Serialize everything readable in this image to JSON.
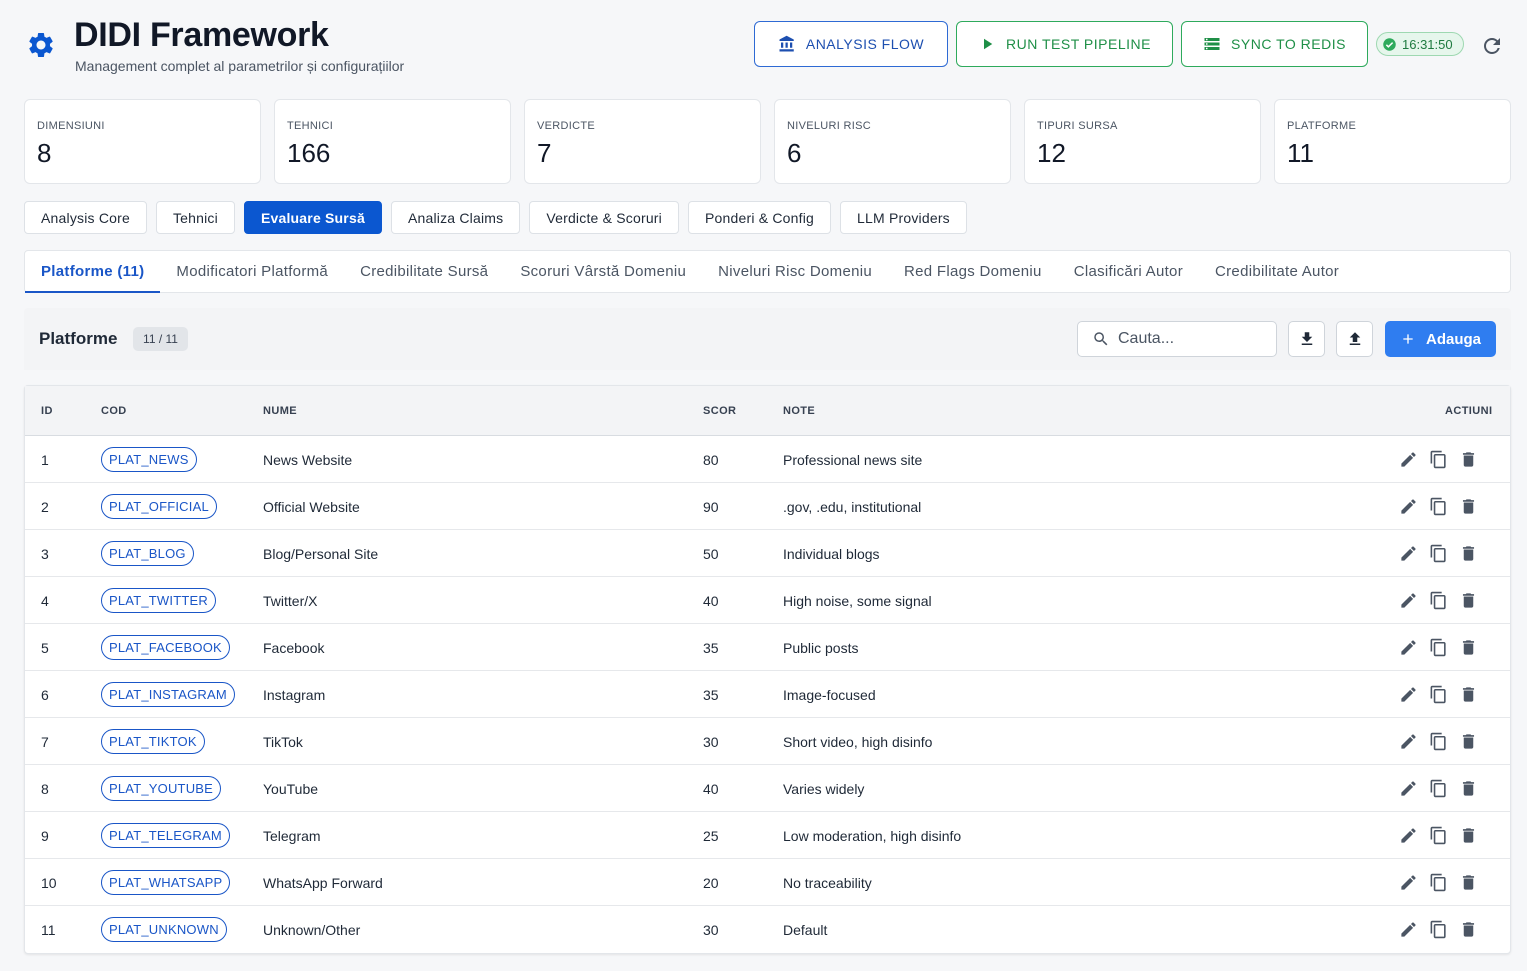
{
  "header": {
    "title": "DIDI Framework",
    "subtitle": "Management complet al parametrilor și configurațiilor",
    "buttons": {
      "analysis_flow": "ANALYSIS FLOW",
      "run_test": "RUN TEST PIPELINE",
      "sync_redis": "SYNC TO REDIS"
    },
    "time": "16:31:50"
  },
  "stats": [
    {
      "label": "DIMENSIUNI",
      "value": "8"
    },
    {
      "label": "TEHNICI",
      "value": "166"
    },
    {
      "label": "VERDICTE",
      "value": "7"
    },
    {
      "label": "NIVELURI RISC",
      "value": "6"
    },
    {
      "label": "TIPURI SURSA",
      "value": "12"
    },
    {
      "label": "PLATFORME",
      "value": "11"
    }
  ],
  "main_tabs": [
    "Analysis Core",
    "Tehnici",
    "Evaluare Sursă",
    "Analiza Claims",
    "Verdicte & Scoruri",
    "Ponderi & Config",
    "LLM Providers"
  ],
  "main_tab_active": "Evaluare Sursă",
  "sub_tabs": [
    "Platforme (11)",
    "Modificatori Platformă",
    "Credibilitate Sursă",
    "Scoruri Vârstă Domeniu",
    "Niveluri Risc Domeniu",
    "Red Flags Domeniu",
    "Clasificări Autor",
    "Credibilitate Autor"
  ],
  "sub_tab_active": "Platforme (11)",
  "toolbar": {
    "title": "Platforme",
    "count": "11 / 11",
    "search_placeholder": "Cauta...",
    "add_label": "Adauga"
  },
  "table": {
    "columns": {
      "id": "ID",
      "cod": "COD",
      "nume": "NUME",
      "scor": "SCOR",
      "note": "NOTE",
      "actiuni": "ACTIUNI"
    },
    "rows": [
      {
        "id": "1",
        "cod": "PLAT_NEWS",
        "nume": "News Website",
        "scor": "80",
        "note": "Professional news site"
      },
      {
        "id": "2",
        "cod": "PLAT_OFFICIAL",
        "nume": "Official Website",
        "scor": "90",
        "note": ".gov, .edu, institutional"
      },
      {
        "id": "3",
        "cod": "PLAT_BLOG",
        "nume": "Blog/Personal Site",
        "scor": "50",
        "note": "Individual blogs"
      },
      {
        "id": "4",
        "cod": "PLAT_TWITTER",
        "nume": "Twitter/X",
        "scor": "40",
        "note": "High noise, some signal"
      },
      {
        "id": "5",
        "cod": "PLAT_FACEBOOK",
        "nume": "Facebook",
        "scor": "35",
        "note": "Public posts"
      },
      {
        "id": "6",
        "cod": "PLAT_INSTAGRAM",
        "nume": "Instagram",
        "scor": "35",
        "note": "Image-focused"
      },
      {
        "id": "7",
        "cod": "PLAT_TIKTOK",
        "nume": "TikTok",
        "scor": "30",
        "note": "Short video, high disinfo"
      },
      {
        "id": "8",
        "cod": "PLAT_YOUTUBE",
        "nume": "YouTube",
        "scor": "40",
        "note": "Varies widely"
      },
      {
        "id": "9",
        "cod": "PLAT_TELEGRAM",
        "nume": "Telegram",
        "scor": "25",
        "note": "Low moderation, high disinfo"
      },
      {
        "id": "10",
        "cod": "PLAT_WHATSAPP",
        "nume": "WhatsApp Forward",
        "scor": "20",
        "note": "No traceability"
      },
      {
        "id": "11",
        "cod": "PLAT_UNKNOWN",
        "nume": "Unknown/Other",
        "scor": "30",
        "note": "Default"
      }
    ]
  },
  "colors": {
    "primary": "#0b57d0",
    "accent": "#2f7df0",
    "success": "#1f8f47"
  },
  "icons": {
    "logo": "gear-icon",
    "analysis_flow": "bank-icon",
    "run": "play-icon",
    "sync": "storage-icon",
    "time": "check-circle-icon",
    "refresh": "refresh-icon",
    "search": "search-icon",
    "download": "download-icon",
    "upload": "upload-icon",
    "add": "plus-icon",
    "row_actions": [
      "edit-icon",
      "copy-icon",
      "delete-icon"
    ]
  }
}
